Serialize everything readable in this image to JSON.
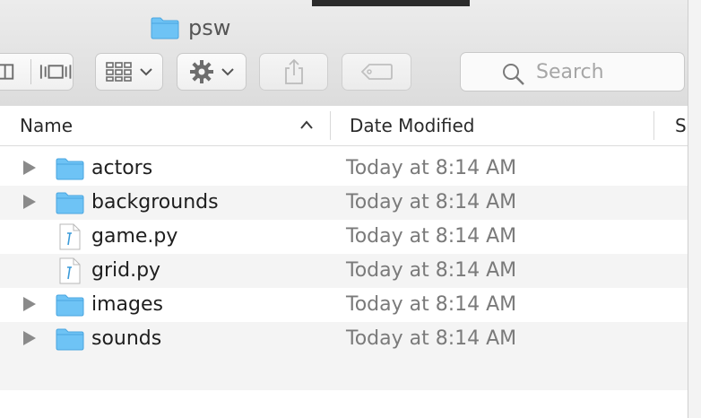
{
  "window": {
    "title": "psw"
  },
  "toolbar": {
    "search_placeholder": "Search"
  },
  "columns": [
    "Name",
    "Date Modified",
    "Siz"
  ],
  "rows": [
    {
      "name": "actors",
      "date": "Today at 8:14 AM",
      "kind": "folder"
    },
    {
      "name": "backgrounds",
      "date": "Today at 8:14 AM",
      "kind": "folder"
    },
    {
      "name": "game.py",
      "date": "Today at 8:14 AM",
      "kind": "file"
    },
    {
      "name": "grid.py",
      "date": "Today at 8:14 AM",
      "kind": "file"
    },
    {
      "name": "images",
      "date": "Today at 8:14 AM",
      "kind": "folder"
    },
    {
      "name": "sounds",
      "date": "Today at 8:14 AM",
      "kind": "folder"
    }
  ],
  "colors": {
    "folder": "#6ec3f5",
    "folder_dark": "#4aa6e0",
    "file_accent": "#3a9ad9"
  }
}
